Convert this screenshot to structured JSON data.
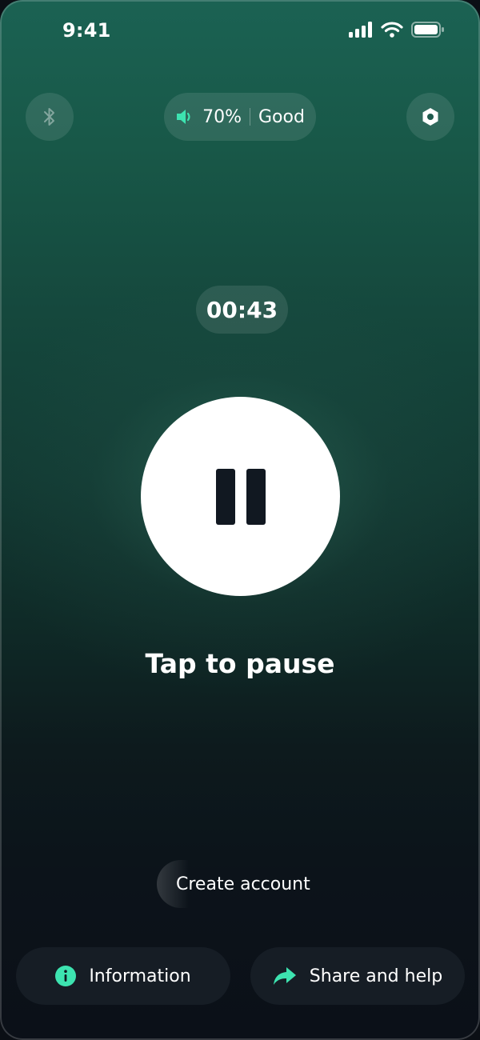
{
  "status_bar": {
    "time": "9:41",
    "icons": [
      "signal-icon",
      "wifi-icon",
      "battery-icon"
    ]
  },
  "top_controls": {
    "bluetooth_icon": "bluetooth-icon",
    "volume": {
      "icon": "speaker-icon",
      "level": "70%",
      "quality": "Good"
    },
    "settings_icon": "hexagon-settings-icon"
  },
  "timer": "00:43",
  "main_button": {
    "icon": "pause-icon",
    "label": "Tap to pause"
  },
  "create_account": "Create account",
  "bottom": {
    "info": {
      "icon": "info-icon",
      "label": "Information"
    },
    "share": {
      "icon": "share-arrow-icon",
      "label": "Share and help"
    }
  },
  "colors": {
    "accent": "#3de3b0",
    "background_top": "#1b6253",
    "background_bottom": "#0b1018",
    "pause_icon": "#111821"
  }
}
